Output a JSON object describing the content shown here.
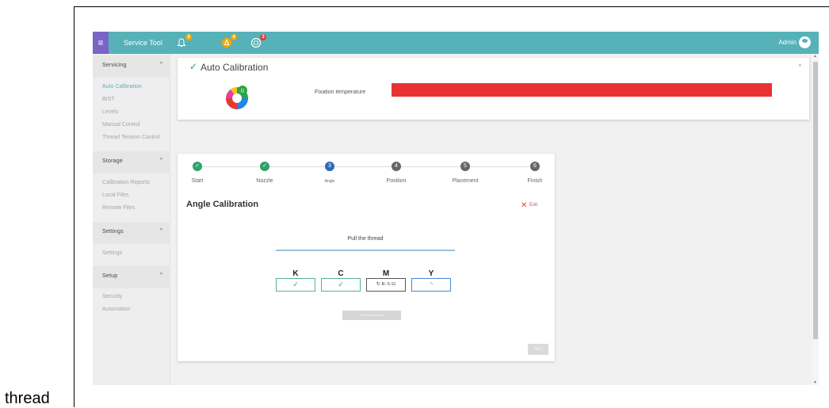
{
  "caption": "thread",
  "topbar": {
    "menu_glyph": "≡",
    "app_title": "Service Tool",
    "icons": [
      {
        "name": "bell-icon",
        "badge": "3",
        "badge_color": "#f2a900"
      },
      {
        "name": "warning-drop-icon",
        "badge": "4",
        "badge_color": "#f2a900"
      },
      {
        "name": "printer-head-icon",
        "badge": "3",
        "badge_color": "#e53935"
      }
    ],
    "admin_label": "Admin"
  },
  "sidebar": {
    "sections": [
      {
        "title": "Servicing",
        "caret": "^",
        "items": [
          "Auto Calibration",
          "BIST",
          "Levels",
          "Manual Control",
          "Thread Tension Control"
        ]
      },
      {
        "title": "Storage",
        "caret": "^",
        "items": [
          "Calibration Reports",
          "Local Files",
          "Remote Files"
        ]
      },
      {
        "title": "Settings",
        "caret": "^",
        "items": [
          "Settings"
        ]
      },
      {
        "title": "Setup",
        "caret": "^",
        "items": [
          "Security",
          "Automation"
        ]
      }
    ],
    "active_item": "Auto Calibration"
  },
  "calibration_card": {
    "check_glyph": "✓",
    "title": "Auto Calibration",
    "caret": "^",
    "fixation_label": "Fixation temperature",
    "temp_bar_color": "#e83232"
  },
  "stepper": {
    "steps": [
      {
        "label": "Start",
        "state": "done",
        "number": "✓"
      },
      {
        "label": "Nozzle",
        "state": "done",
        "number": "✓"
      },
      {
        "label": "Angle",
        "state": "active",
        "number": "3"
      },
      {
        "label": "Position",
        "state": "todo",
        "number": "4"
      },
      {
        "label": "Placement",
        "state": "todo",
        "number": "5"
      },
      {
        "label": "Finish",
        "state": "todo",
        "number": "6"
      }
    ],
    "colors": {
      "done": "#2ea36a",
      "active": "#2b6cb8",
      "todo": "#666666"
    }
  },
  "angle": {
    "title": "Angle Calibration",
    "exit_glyph": "✕",
    "exit_label": "Exit",
    "instruction": "Pull the thread",
    "channels": [
      {
        "letter": "K",
        "status": "done",
        "value": "✓"
      },
      {
        "letter": "C",
        "status": "done",
        "value": "✓"
      },
      {
        "letter": "M",
        "status": "progress",
        "value": "↻ R: 0.32"
      },
      {
        "letter": "Y",
        "status": "loading",
        "value": "◝"
      }
    ],
    "verify_label": "Verify Adjustment",
    "next_label": "Next"
  }
}
